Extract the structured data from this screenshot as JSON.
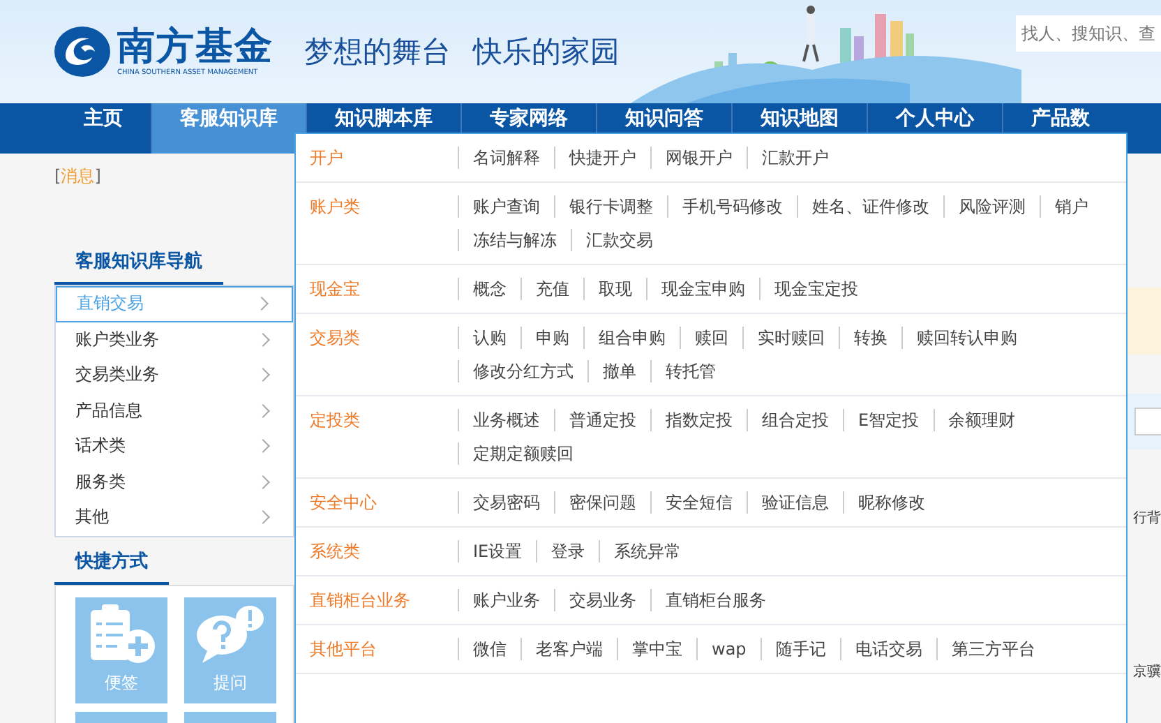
{
  "header": {
    "logo": {
      "name": "南方基金",
      "subtitle": "CHINA SOUTHERN ASSET MANAGEMENT"
    },
    "slogan": [
      "梦想的舞台",
      "快乐的家园"
    ],
    "search": {
      "placeholder": "找人、搜知识、查"
    }
  },
  "nav": [
    {
      "label": "主页",
      "selected": false
    },
    {
      "label": "客服知识库",
      "selected": true
    },
    {
      "label": "知识脚本库",
      "selected": false
    },
    {
      "label": "专家网络",
      "selected": false
    },
    {
      "label": "知识问答",
      "selected": false
    },
    {
      "label": "知识地图",
      "selected": false
    },
    {
      "label": "个人中心",
      "selected": false
    },
    {
      "label": "产品数",
      "selected": false
    }
  ],
  "message_link": {
    "open": "[",
    "label": "消息",
    "close": "]"
  },
  "sidebar": {
    "title": "客服知识库导航",
    "items": [
      {
        "label": "直销交易",
        "selected": true
      },
      {
        "label": "账户类业务",
        "selected": false
      },
      {
        "label": "交易类业务",
        "selected": false
      },
      {
        "label": "产品信息",
        "selected": false
      },
      {
        "label": "话术类",
        "selected": false
      },
      {
        "label": "服务类",
        "selected": false
      },
      {
        "label": "其他",
        "selected": false
      }
    ]
  },
  "shortcuts": {
    "title": "快捷方式",
    "tiles": [
      {
        "kind": "note",
        "label": "便签"
      },
      {
        "kind": "question",
        "label": "提问"
      },
      {
        "kind": "blank"
      },
      {
        "kind": "blank"
      }
    ]
  },
  "dropdown": [
    {
      "category": "开户",
      "lines": [
        [
          "名词解释",
          "快捷开户",
          "网银开户",
          "汇款开户"
        ]
      ]
    },
    {
      "category": "账户类",
      "lines": [
        [
          "账户查询",
          "银行卡调整",
          "手机号码修改",
          "姓名、证件修改",
          "风险评测",
          "销户"
        ],
        [
          "冻结与解冻",
          "汇款交易"
        ]
      ]
    },
    {
      "category": "现金宝",
      "lines": [
        [
          "概念",
          "充值",
          "取现",
          "现金宝申购",
          "现金宝定投"
        ]
      ]
    },
    {
      "category": "交易类",
      "lines": [
        [
          "认购",
          "申购",
          "组合申购",
          "赎回",
          "实时赎回",
          "转换",
          "赎回转认申购"
        ],
        [
          "修改分红方式",
          "撤单",
          "转托管"
        ]
      ]
    },
    {
      "category": "定投类",
      "lines": [
        [
          "业务概述",
          "普通定投",
          "指数定投",
          "组合定投",
          "E智定投",
          "余额理财"
        ],
        [
          "定期定额赎回"
        ]
      ]
    },
    {
      "category": "安全中心",
      "lines": [
        [
          "交易密码",
          "密保问题",
          "安全短信",
          "验证信息",
          "昵称修改"
        ]
      ]
    },
    {
      "category": "系统类",
      "lines": [
        [
          "IE设置",
          "登录",
          "系统异常"
        ]
      ]
    },
    {
      "category": "直销柜台业务",
      "lines": [
        [
          "账户业务",
          "交易业务",
          "直销柜台服务"
        ]
      ]
    },
    {
      "category": "其他平台",
      "lines": [
        [
          "微信",
          "老客户端",
          "掌中宝",
          "wap",
          "随手记",
          "电话交易",
          "第三方平台"
        ]
      ]
    }
  ],
  "background_texts": [
    "行背",
    "京骥"
  ]
}
